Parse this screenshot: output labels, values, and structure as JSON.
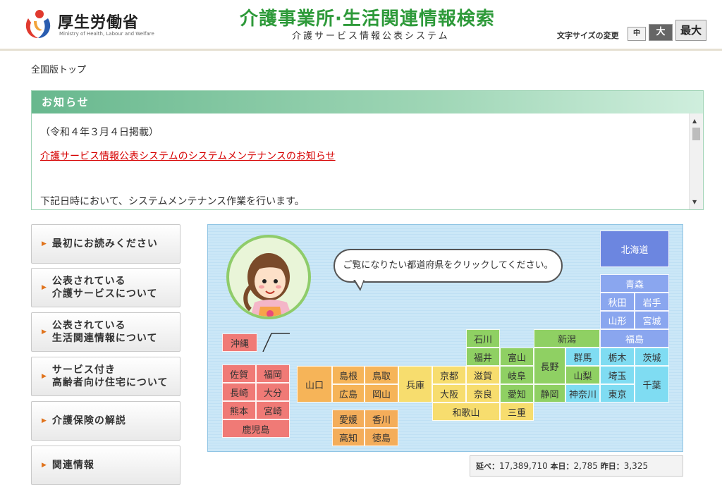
{
  "header": {
    "logo_name": "厚生労働省",
    "logo_sub": "Ministry of Health, Labour and Welfare",
    "site_title": "介護事業所·生活関連情報検索",
    "site_subtitle": "介護サービス情報公表システム",
    "font_size_label": "文字サイズの変更",
    "font_size_options": [
      "中",
      "大",
      "最大"
    ]
  },
  "breadcrumb": "全国版トップ",
  "notice": {
    "title": "お知らせ",
    "date": "（令和４年３月４日掲載）",
    "link_text": "介護サービス情報公表システムのシステムメンテナンスのお知らせ",
    "cut_text": "下記日時において、システムメンテナンス作業を行います。"
  },
  "menu": [
    {
      "label": "最初にお読みください"
    },
    {
      "label": "公表されている\n介護サービスについて"
    },
    {
      "label": "公表されている\n生活関連情報について"
    },
    {
      "label": "サービス付き\n高齢者向け住宅について"
    },
    {
      "label": "介護保険の解説"
    },
    {
      "label": "関連情報"
    }
  ],
  "map": {
    "instruction": "ご覧になりたい都道府県をクリックしてください。",
    "prefectures": {
      "hokkaido": "北海道",
      "aomori": "青森",
      "akita": "秋田",
      "iwate": "岩手",
      "yamagata": "山形",
      "miyagi": "宮城",
      "fukushima": "福島",
      "gunma": "群馬",
      "tochigi": "栃木",
      "ibaraki": "茨城",
      "saitama": "埼玉",
      "chiba": "千葉",
      "tokyo": "東京",
      "kanagawa": "神奈川",
      "niigata": "新潟",
      "ishikawa": "石川",
      "fukui": "福井",
      "toyama": "富山",
      "nagano": "長野",
      "yamanashi": "山梨",
      "gifu": "岐阜",
      "shizuoka": "静岡",
      "aichi": "愛知",
      "kyoto": "京都",
      "shiga": "滋賀",
      "osaka": "大阪",
      "nara": "奈良",
      "wakayama": "和歌山",
      "mie": "三重",
      "hyogo": "兵庫",
      "shimane": "島根",
      "tottori": "鳥取",
      "hiroshima": "広島",
      "okayama": "岡山",
      "yamaguchi": "山口",
      "ehime": "愛媛",
      "kagawa": "香川",
      "kochi": "高知",
      "tokushima": "徳島",
      "saga": "佐賀",
      "fukuoka": "福岡",
      "nagasaki": "長崎",
      "oita": "大分",
      "kumamoto": "熊本",
      "miyazaki": "宮崎",
      "kagoshima": "鹿児島",
      "okinawa": "沖縄"
    }
  },
  "counter": {
    "total_label": "延べ：",
    "total_value": "17,389,710",
    "today_label": "本日：",
    "today_value": "2,785",
    "yesterday_label": "昨日：",
    "yesterday_value": "3,325"
  }
}
